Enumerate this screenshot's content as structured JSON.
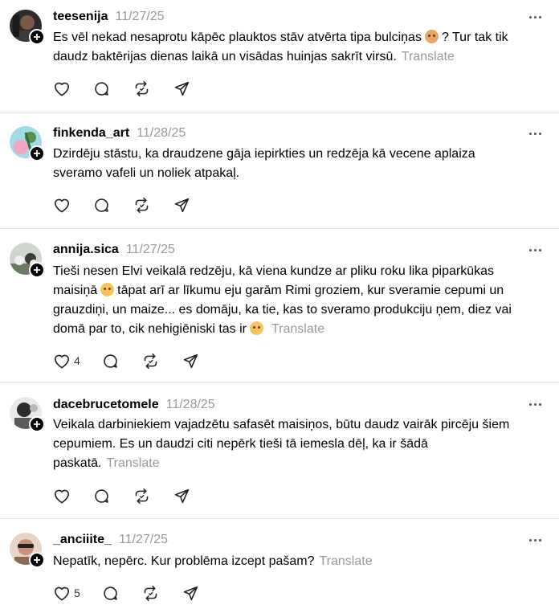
{
  "posts": [
    {
      "username": "teesenija",
      "date": "11/27/25",
      "text_parts": [
        "Es vēl nekad nesaprotu kāpēc plauktos stāv atvērta tipa bulciņas",
        "? Tur tak tik daudz baktērijas dienas laikā un visādas huinjas sakrīt virsū."
      ],
      "translate": "Translate",
      "likes": ""
    },
    {
      "username": "finkenda_art",
      "date": "11/28/25",
      "text_parts": [
        "Dzirdēju stāstu, ka draudzene gāja iepirkties un redzēja kā vecene aplaiza sveramo vafeli un noliek atpakaļ."
      ],
      "translate": "",
      "likes": ""
    },
    {
      "username": "annija.sica",
      "date": "11/27/25",
      "text_parts": [
        "Tieši nesen Elvi veikalā redzēju, kā viena kundze ar pliku roku lika piparkūkas maisiņā",
        "tāpat arī ar līkumu eju garām Rimi groziem, kur sveramie cepumi un grauzdiņi, un maize... es domāju, ka tie, kas to sveramo produkciju ņem, diez vai domā par to, cik nehigiēniski tas ir"
      ],
      "translate": "Translate",
      "likes": "4"
    },
    {
      "username": "dacebrucetomele",
      "date": "11/28/25",
      "text_parts": [
        "Veikala darbiniekiem vajadzētu safasēt maisiņos, būtu daudz vairāk pircēju šiem cepumiem. Es un daudzi citi nepērk tieši tā iemesla dēļ, ka ir šādā paskatā."
      ],
      "translate": "Translate",
      "likes": ""
    },
    {
      "username": "_anciiite_",
      "date": "11/27/25",
      "text_parts": [
        "Nepatīk, nepērc. Kur problēma izcept pašam?"
      ],
      "translate": "Translate",
      "likes": "5"
    }
  ],
  "icons": {
    "like": "heart-icon",
    "reply": "comment-icon",
    "repost": "repost-icon",
    "share": "send-icon",
    "more": "more-horizontal-icon",
    "follow": "plus-icon"
  }
}
